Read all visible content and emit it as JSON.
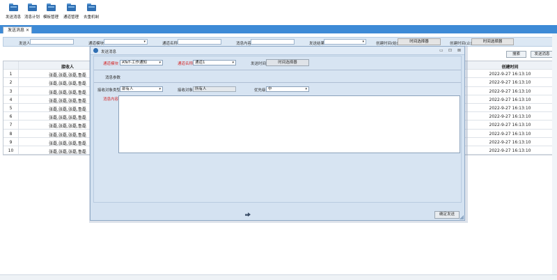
{
  "toolbar": {
    "items": [
      {
        "label": "发送消息",
        "icon": "folder-icon"
      },
      {
        "label": "消息计划",
        "icon": "folder-icon"
      },
      {
        "label": "模板管理",
        "icon": "folder-icon"
      },
      {
        "label": "通道管理",
        "icon": "folder-icon"
      },
      {
        "label": "去重机制",
        "icon": "folder-icon"
      }
    ]
  },
  "tabs": {
    "active_label": "发送消息",
    "close_glyph": "✕"
  },
  "filters": {
    "sender_label": "发送人",
    "channel_module_label": "通道模块",
    "channel_name_label": "通道名称",
    "content_label": "消息内容",
    "result_label": "发送结果",
    "created_from_label": "创建时间(始)",
    "created_to_label": "创建时间(止)",
    "time_picker_label": "时间选择器",
    "select_arrow": "▾"
  },
  "actions": {
    "search_label": "搜索",
    "send_label": "发送消息"
  },
  "table": {
    "headers": {
      "receiver": "接收人",
      "created_time": "创建时间"
    },
    "rows": [
      {
        "index": "1",
        "receiver": "张磊,张磊,张磊,鲁磊",
        "time": "2022-9-27 16:13:10"
      },
      {
        "index": "2",
        "receiver": "张磊,张磊,张磊,鲁磊",
        "time": "2022-9-27 16:13:10"
      },
      {
        "index": "3",
        "receiver": "张磊,张磊,张磊,鲁磊",
        "time": "2022-9-27 16:13:10"
      },
      {
        "index": "4",
        "receiver": "张磊,张磊,张磊,鲁磊",
        "time": "2022-9-27 16:13:10"
      },
      {
        "index": "5",
        "receiver": "张磊,张磊,张磊,鲁磊",
        "time": "2022-9-27 16:13:10"
      },
      {
        "index": "6",
        "receiver": "张磊,张磊,张磊,鲁磊",
        "time": "2022-9-27 16:13:10"
      },
      {
        "index": "7",
        "receiver": "张磊,张磊,张磊,鲁磊",
        "time": "2022-9-27 16:13:10"
      },
      {
        "index": "8",
        "receiver": "张磊,张磊,张磊,鲁磊",
        "time": "2022-9-27 16:13:10"
      },
      {
        "index": "9",
        "receiver": "张磊,张磊,张磊,鲁磊",
        "time": "2022-9-27 16:13:10"
      },
      {
        "index": "10",
        "receiver": "张磊,张磊,张磊,鲁磊",
        "time": "2022-9-27 16:13:10"
      }
    ]
  },
  "modal": {
    "title": "发送消息",
    "controls": {
      "minimize": "▭",
      "maximize": "⊡",
      "close": "⊠"
    },
    "channel_module_label": "通道模块",
    "channel_module_value": "ATeT-工作通知",
    "channel_name_label": "通道名称",
    "channel_name_value": "通道1",
    "send_time_label": "发送时间",
    "send_time_picker": "时间选择器",
    "section_label": "消息参数",
    "receiver_type_label": "接收对象类型",
    "receiver_type_value": "部有人",
    "receiver_label": "接收对象",
    "receiver_value": "所有人",
    "priority_label": "优先级",
    "priority_value": "中",
    "content_label": "消息内容",
    "confirm_label": "确定发送",
    "footer_icon": "send-icon"
  }
}
